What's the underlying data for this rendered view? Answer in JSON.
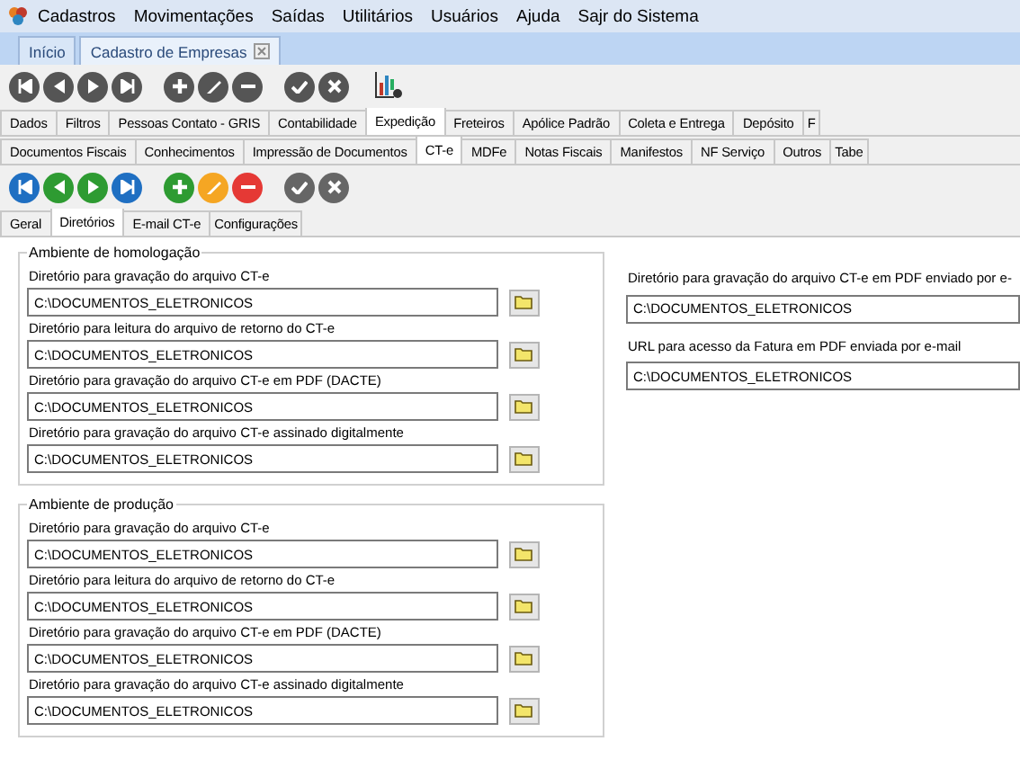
{
  "menu": [
    "Cadastros",
    "Movimentações",
    "Saídas",
    "Utilitários",
    "Usuários",
    "Ajuda",
    "Sajr do Sistema"
  ],
  "doc_tabs": [
    {
      "label": "Início",
      "selected": false,
      "closable": false
    },
    {
      "label": "Cadastro de Empresas",
      "selected": true,
      "closable": true
    }
  ],
  "main_tabs": [
    {
      "label": "Dados",
      "selected": false
    },
    {
      "label": "Filtros",
      "selected": false
    },
    {
      "label": "Pessoas Contato - GRIS",
      "selected": false
    },
    {
      "label": "Contabilidade",
      "selected": false
    },
    {
      "label": "Expedição",
      "selected": true
    },
    {
      "label": "Freteiros",
      "selected": false
    },
    {
      "label": "Apólice Padrão",
      "selected": false
    },
    {
      "label": "Coleta e Entrega",
      "selected": false
    },
    {
      "label": "Depósito",
      "selected": false
    },
    {
      "label": "F",
      "selected": false
    }
  ],
  "sub_tabs": [
    {
      "label": "Documentos Fiscais",
      "selected": false
    },
    {
      "label": "Conhecimentos",
      "selected": false
    },
    {
      "label": "Impressão de Documentos",
      "selected": false
    },
    {
      "label": "CT-e",
      "selected": true
    },
    {
      "label": "MDFe",
      "selected": false
    },
    {
      "label": "Notas Fiscais",
      "selected": false
    },
    {
      "label": "Manifestos",
      "selected": false
    },
    {
      "label": "NF Serviço",
      "selected": false
    },
    {
      "label": "Outros",
      "selected": false
    },
    {
      "label": "Tabe",
      "selected": false
    }
  ],
  "cte_tabs": [
    {
      "label": "Geral",
      "selected": false
    },
    {
      "label": "Diretórios",
      "selected": true
    },
    {
      "label": "E-mail CT-e",
      "selected": false
    },
    {
      "label": "Configurações",
      "selected": false
    }
  ],
  "groups": [
    {
      "title": "Ambiente de homologação",
      "fields": [
        {
          "label": "Diretório para gravação do arquivo CT-e",
          "value": "C:\\DOCUMENTOS_ELETRONICOS"
        },
        {
          "label": "Diretório para leitura do arquivo de retorno do CT-e",
          "value": "C:\\DOCUMENTOS_ELETRONICOS"
        },
        {
          "label": "Diretório para gravação do arquivo CT-e em PDF (DACTE)",
          "value": "C:\\DOCUMENTOS_ELETRONICOS"
        },
        {
          "label": "Diretório para gravação do arquivo CT-e assinado digitalmente",
          "value": "C:\\DOCUMENTOS_ELETRONICOS"
        }
      ]
    },
    {
      "title": "Ambiente de produção",
      "fields": [
        {
          "label": "Diretório para gravação do arquivo CT-e",
          "value": "C:\\DOCUMENTOS_ELETRONICOS"
        },
        {
          "label": "Diretório para leitura do arquivo de retorno do CT-e",
          "value": "C:\\DOCUMENTOS_ELETRONICOS"
        },
        {
          "label": "Diretório para gravação do arquivo CT-e em PDF (DACTE)",
          "value": "C:\\DOCUMENTOS_ELETRONICOS"
        },
        {
          "label": "Diretório para gravação do arquivo CT-e assinado digitalmente",
          "value": "C:\\DOCUMENTOS_ELETRONICOS"
        }
      ]
    }
  ],
  "right_fields": [
    {
      "label": "Diretório para gravação do arquivo CT-e em PDF enviado por e-",
      "value": "C:\\DOCUMENTOS_ELETRONICOS"
    },
    {
      "label": "URL para acesso da Fatura em PDF enviada por e-mail",
      "value": "C:\\DOCUMENTOS_ELETRONICOS"
    }
  ]
}
